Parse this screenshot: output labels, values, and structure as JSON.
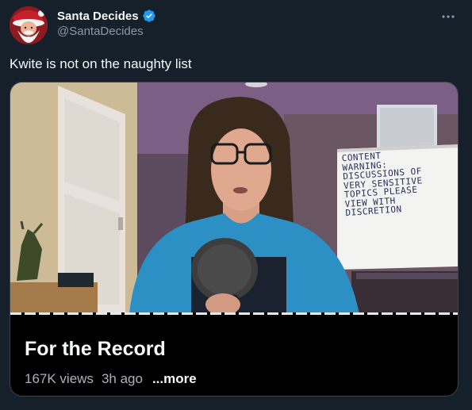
{
  "author": {
    "display_name": "Santa Decides",
    "handle": "@SantaDecides",
    "verified": true
  },
  "tweet": {
    "text": "Kwite is not on the naughty list"
  },
  "media": {
    "whiteboard_lines": [
      "CONTENT",
      "WARNING:",
      "DISCUSSIONS OF",
      "VERY SENSITIVE",
      "TOPICS PLEASE",
      "VIEW WITH",
      "DISCRETION"
    ],
    "title": "For the Record",
    "views": "167K views",
    "age": "3h ago",
    "more_label": "...more"
  },
  "icons": {
    "verified": "verified-badge-icon",
    "more": "more-horizontal-icon"
  },
  "colors": {
    "background": "#15202b",
    "verified": "#1d9bf0",
    "muted": "#8b98a5",
    "border": "#38444d"
  }
}
